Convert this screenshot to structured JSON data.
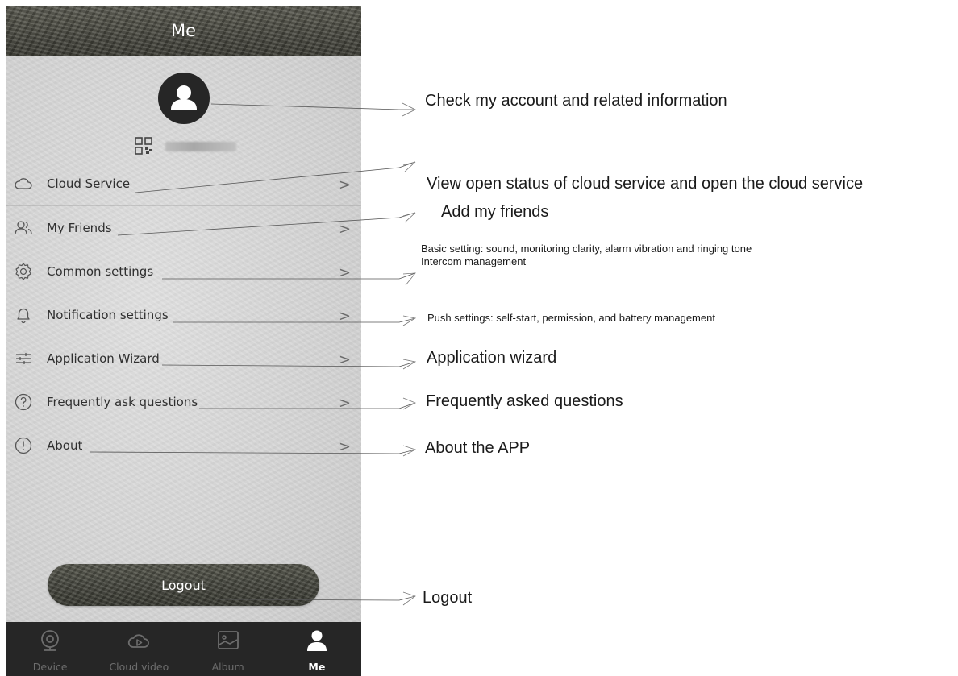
{
  "header": {
    "title": "Me"
  },
  "menu": [
    {
      "label": "Cloud Service",
      "icon": "cloud-icon"
    },
    {
      "label": "My Friends",
      "icon": "friends-icon"
    },
    {
      "label": "Common settings",
      "icon": "settings-icon"
    },
    {
      "label": "Notification settings",
      "icon": "bell-icon"
    },
    {
      "label": "Application Wizard",
      "icon": "sliders-icon"
    },
    {
      "label": "Frequently ask questions",
      "icon": "question-icon"
    },
    {
      "label": "About",
      "icon": "info-icon"
    }
  ],
  "chevron": ">",
  "logout": {
    "label": "Logout"
  },
  "tabs": [
    {
      "label": "Device",
      "icon": "camera-icon"
    },
    {
      "label": "Cloud video",
      "icon": "cloud-play-icon"
    },
    {
      "label": "Album",
      "icon": "album-icon"
    },
    {
      "label": "Me",
      "icon": "person-icon",
      "active": true
    }
  ],
  "annotations": {
    "account": "Check my account and related information",
    "cloud": "View open status of cloud service and open the cloud service",
    "friends": "Add my friends",
    "common_line1": "Basic setting: sound, monitoring clarity, alarm vibration and ringing tone",
    "common_line2": "Intercom management",
    "push": "Push settings: self-start, permission, and battery management",
    "wizard": "Application wizard",
    "faq": "Frequently asked questions",
    "about": "About the APP",
    "logout": "Logout"
  },
  "colors": {
    "header_bg": "#4a4a42",
    "screen_bg": "#d8d8d8",
    "tabbar_bg": "#262626",
    "tab_active": "#ffffff",
    "tab_inactive": "#6d6d6d",
    "text": "#2f2f2f"
  }
}
